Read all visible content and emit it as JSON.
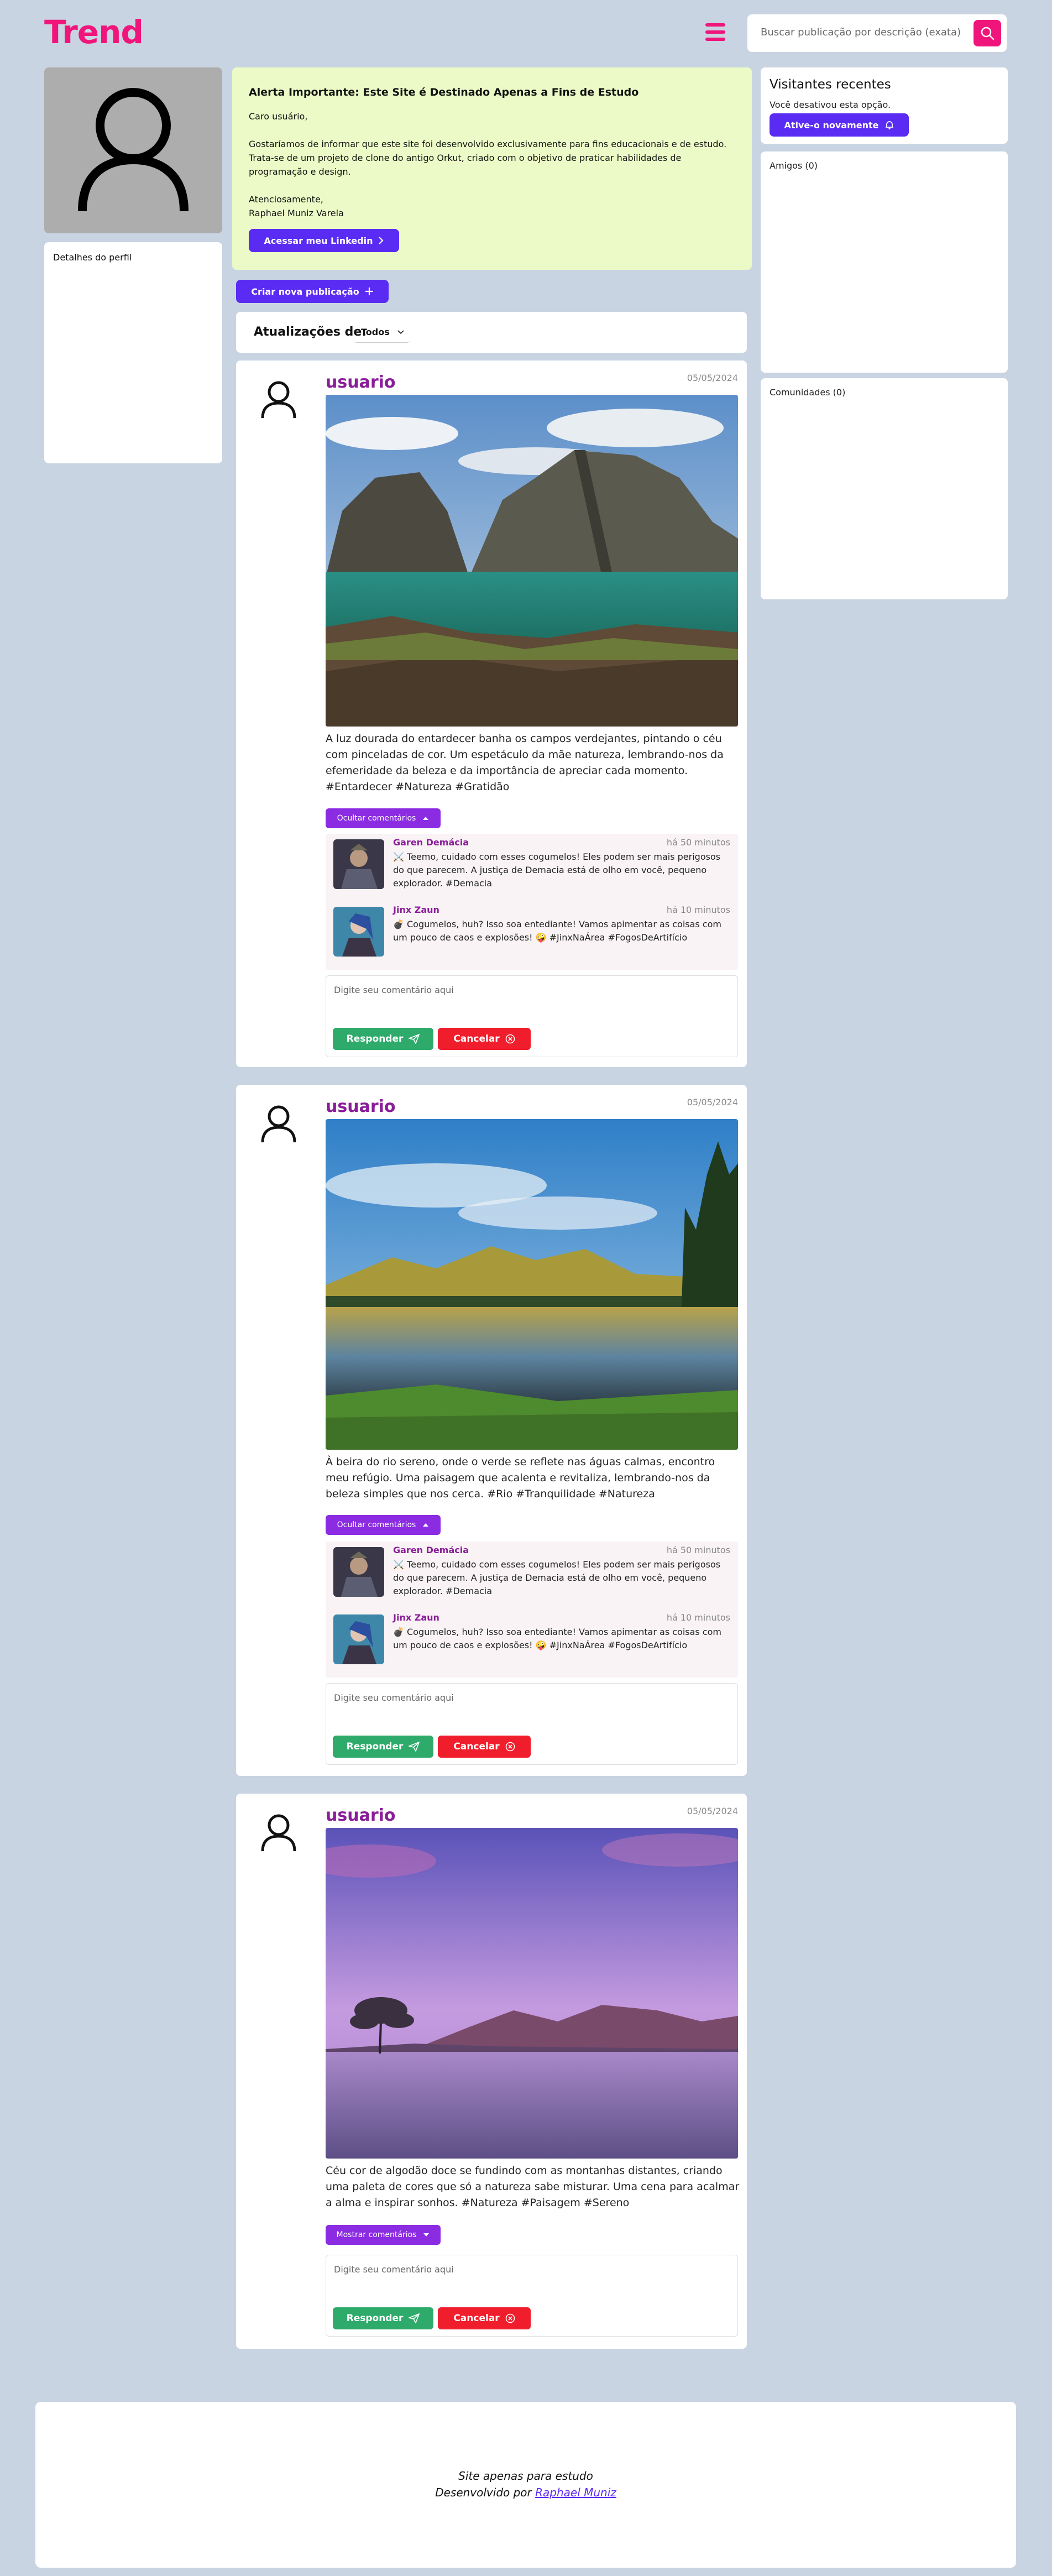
{
  "header": {
    "logo": "Trend",
    "search_placeholder": "Buscar publicação por descrição (exata)"
  },
  "profile": {
    "details_label": "Detalhes do perfil"
  },
  "alert": {
    "title": "Alerta Importante: Este Site é Destinado Apenas a Fins de Estudo",
    "greeting": "Caro usuário,",
    "p1": "Gostaríamos de informar que este site foi desenvolvido exclusivamente para fins educacionais e de estudo.",
    "p2": "Trata-se de um projeto de clone do antigo Orkut, criado com o objetivo de praticar habilidades de programação e design.",
    "closing": "Atenciosamente,",
    "author": "Raphael Muniz Varela",
    "linkedin_button": "Acessar meu Linkedin"
  },
  "create_post_button": "Criar nova publicação",
  "updates": {
    "label": "Atualizações de:",
    "selected": "Todos"
  },
  "sidebar": {
    "visitors_title": "Visitantes recentes",
    "visitors_disabled": "Você desativou esta opção.",
    "visitors_button": "Ative-o novamente",
    "friends": "Amigos (0)",
    "communities": "Comunidades (0)"
  },
  "reply": {
    "placeholder": "Digite seu comentário aqui",
    "reply_button": "Responder",
    "cancel_button": "Cancelar"
  },
  "comments": [
    {
      "author": "Garen Demácia",
      "time": "há 50 minutos",
      "text": "⚔️ Teemo, cuidado com esses cogumelos! Eles podem ser mais perigosos do que parecem. A justiça de Demacia está de olho em você, pequeno explorador. #Demacia"
    },
    {
      "author": "Jinx Zaun",
      "time": "há 10 minutos",
      "text": "💣 Cogumelos, huh? Isso soa entediante! Vamos apimentar as coisas com um pouco de caos e explosões! 🤪 #JinxNaÁrea #FogosDeArtifício"
    }
  ],
  "posts": [
    {
      "username": "usuario",
      "date": "05/05/2024",
      "description": "A luz dourada do entardecer banha os campos verdejantes, pintando o céu com pinceladas de cor. Um espetáculo da mãe natureza, lembrando-nos da efemeridade da beleza e da importância de apreciar cada momento. #Entardecer #Natureza #Gratidão",
      "toggle_label": "Ocultar comentários"
    },
    {
      "username": "usuario",
      "date": "05/05/2024",
      "description": "À beira do rio sereno, onde o verde se reflete nas águas calmas, encontro meu refúgio. Uma paisagem que acalenta e revitaliza, lembrando-nos da beleza simples que nos cerca. #Rio #Tranquilidade #Natureza",
      "toggle_label": "Ocultar comentários"
    },
    {
      "username": "usuario",
      "date": "05/05/2024",
      "description": "Céu cor de algodão doce se fundindo com as montanhas distantes, criando uma paleta de cores que só a natureza sabe misturar. Uma cena para acalmar a alma e inspirar sonhos. #Natureza #Paisagem #Sereno",
      "toggle_label": "Mostrar comentários"
    }
  ],
  "footer": {
    "line1": "Site apenas para estudo",
    "line2_prefix": "Desenvolvido por",
    "line2_link": "Raphael Muniz"
  },
  "colors": {
    "brand": "#f0157b",
    "purple": "#5a2bf3",
    "violet": "#8b2be2",
    "username": "#8a1d99",
    "green": "#2eab6b",
    "red": "#f01e2c",
    "background": "#c9d4e2",
    "alert_bg": "#ebfac6"
  }
}
